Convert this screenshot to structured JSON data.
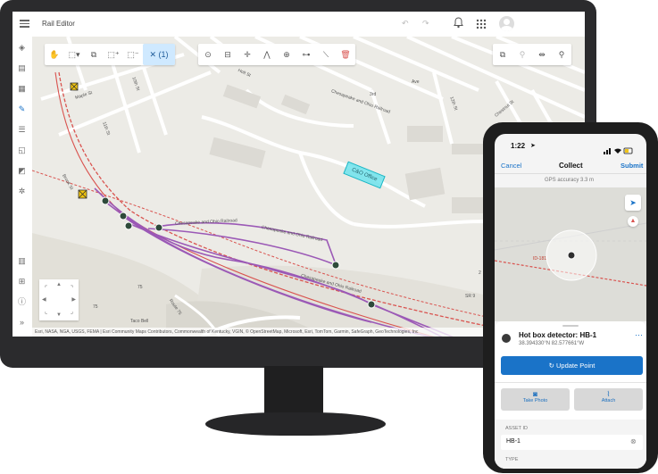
{
  "app": {
    "title": "Rail Editor"
  },
  "toolbar": {
    "selection_count": "(1)"
  },
  "map": {
    "labels": {
      "maple": "Maple St",
      "st10": "10th St",
      "st11": "11th St",
      "chesapeake1": "Chesapeake and Ohio Railroad",
      "chesapeake2": "Chesapeake and Ohio Railroad",
      "chesapeake3": "Chesapeake and Ohio Railroad",
      "chesapeake4": "Chesapeake and Ohio Railroad",
      "office": "C&O Office",
      "taco": "Taco Bell",
      "chestnut": "Chestnut St",
      "rt75": "75",
      "rt2": "2",
      "route75": "Route 75",
      "brook": "Brook St",
      "sr9": "SR 9",
      "rd1": "3rd",
      "rd2": "12th St",
      "rd3": "Ave",
      "rd4": "Holt St",
      "rd5": "75"
    },
    "credits": "Esri, NASA, NGA, USGS, FEMA | Esri Community Maps Contributors, Commonwealth of Kentucky, VGIN, © OpenStreetMap, Microsoft, Esri, TomTom, Garmin, SafeGraph, GeoTechnologies, Inc"
  },
  "phone": {
    "time": "1:22",
    "nav": {
      "cancel": "Cancel",
      "title": "Collect",
      "submit": "Submit"
    },
    "gps": "GPS accuracy 3.3 m",
    "map_label": "ID-181",
    "feature": {
      "title": "Hot box detector: HB-1",
      "coords": "38.394330°N  82.577661°W"
    },
    "update_button": "Update Point",
    "take_photo": "Take Photo",
    "attach": "Attach",
    "asset_id_label": "ASSET ID",
    "asset_id_value": "HB-1",
    "next_label": "TYPE"
  },
  "colors": {
    "accent": "#1a73c8",
    "track": "#9b59b6",
    "rail": "#d9534f",
    "selection": "#39d3e0"
  }
}
